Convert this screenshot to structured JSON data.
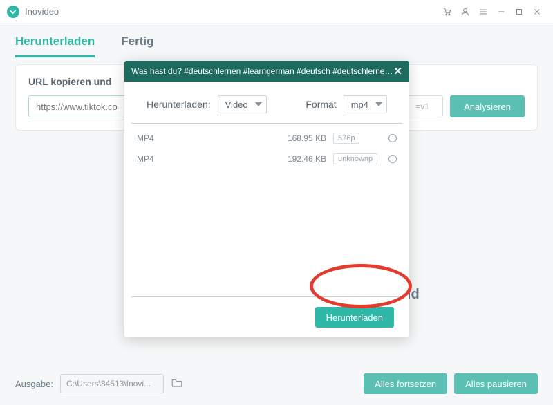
{
  "app": {
    "name": "Inovideo"
  },
  "tabs": {
    "download": "Herunterladen",
    "done": "Fertig"
  },
  "panel": {
    "title": "URL kopieren und",
    "url_placeholder": "https://www.tiktok.co",
    "url_suffix": "=v1",
    "analyze": "Analysieren"
  },
  "bg_text": "efeld",
  "footer": {
    "label": "Ausgabe:",
    "path": "C:\\Users\\84513\\Inovi...",
    "resume": "Alles fortsetzen",
    "pause": "Alles pausieren"
  },
  "modal": {
    "title": "Was hast du? #deutschlernen #learngerman #deutsch #deutschlernend...",
    "download_label": "Herunterladen:",
    "download_value": "Video",
    "format_label": "Format",
    "format_value": "mp4",
    "rows": [
      {
        "format": "MP4",
        "size": "168.95 KB",
        "chip": "576p"
      },
      {
        "format": "MP4",
        "size": "192.46 KB",
        "chip": "unknownp"
      }
    ],
    "download_button": "Herunterladen"
  }
}
